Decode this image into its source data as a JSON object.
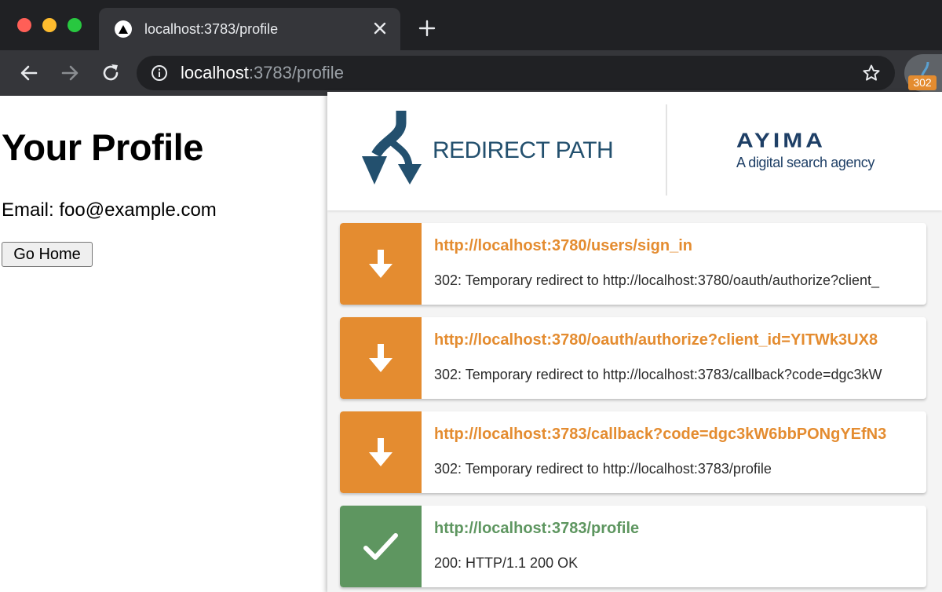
{
  "browser": {
    "tab_title": "localhost:3783/profile",
    "url_host": "localhost",
    "url_rest": ":3783/profile",
    "extension_badge": "302"
  },
  "page": {
    "heading": "Your Profile",
    "email_line": "Email: foo@example.com",
    "go_home_label": "Go Home"
  },
  "popup": {
    "brand_title": "REDIRECT PATH",
    "partner_logo_text": "AYIMA",
    "partner_tagline": "A digital search agency",
    "colors": {
      "redirect": "#e48c30",
      "success": "#5e9660",
      "brand_blue": "#23506e"
    },
    "hops": [
      {
        "icon": "arrow-down-icon",
        "status": "redirect",
        "url": "http://localhost:3780/users/sign_in",
        "detail": "302: Temporary redirect to http://localhost:3780/oauth/authorize?client_"
      },
      {
        "icon": "arrow-down-icon",
        "status": "redirect",
        "url": "http://localhost:3780/oauth/authorize?client_id=YITWk3UX8",
        "detail": "302: Temporary redirect to http://localhost:3783/callback?code=dgc3kW"
      },
      {
        "icon": "arrow-down-icon",
        "status": "redirect",
        "url": "http://localhost:3783/callback?code=dgc3kW6bbPONgYEfN3",
        "detail": "302: Temporary redirect to http://localhost:3783/profile"
      },
      {
        "icon": "checkmark-icon",
        "status": "success",
        "url": "http://localhost:3783/profile",
        "detail": "200: HTTP/1.1 200 OK"
      }
    ]
  }
}
